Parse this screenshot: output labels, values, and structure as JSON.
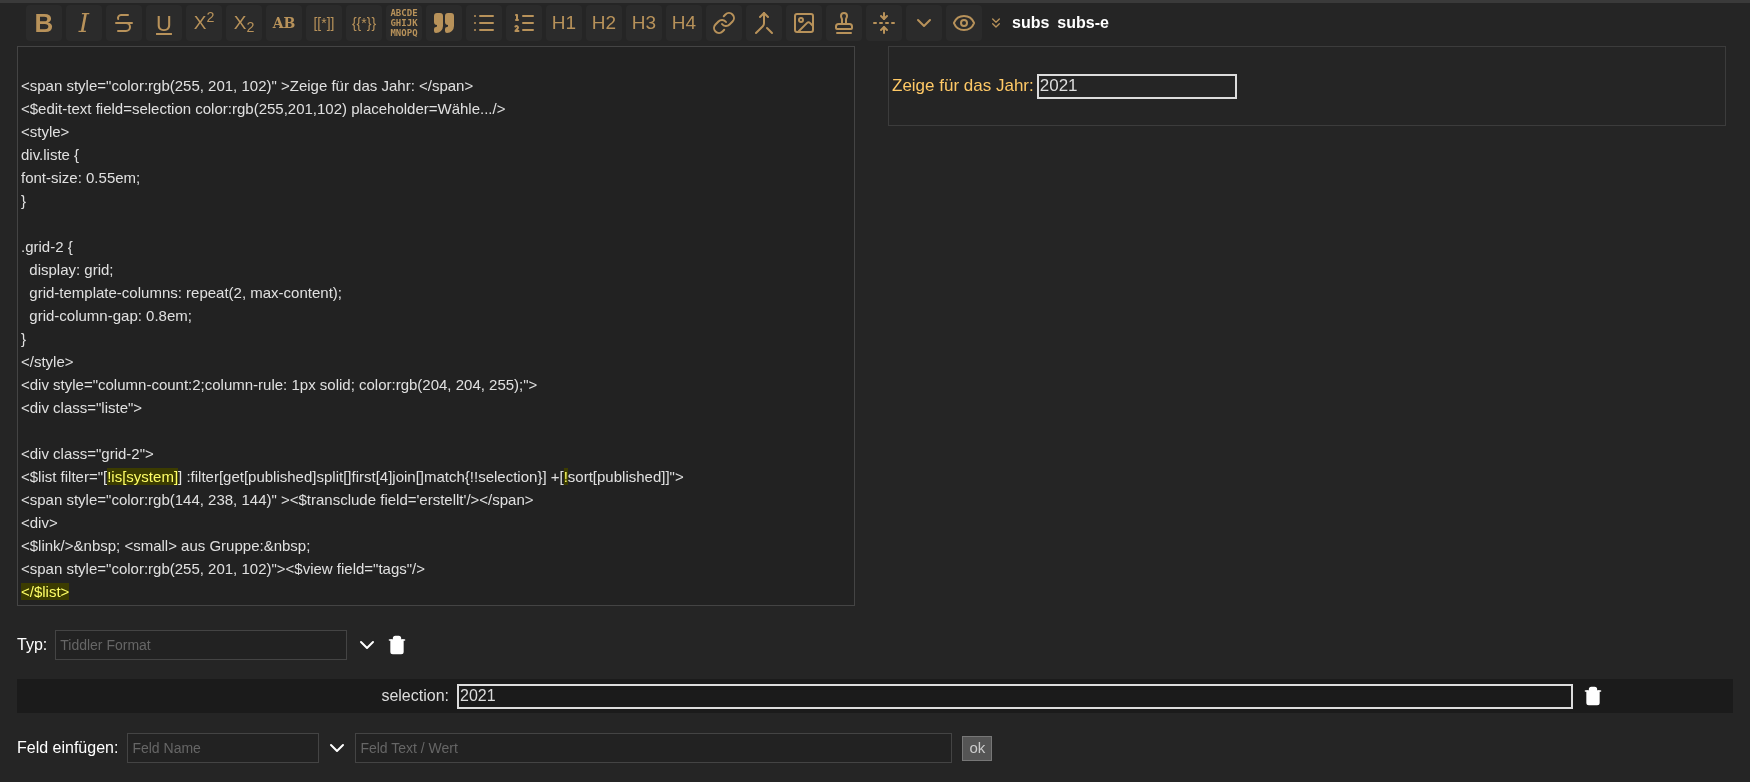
{
  "toolbar": [
    {
      "kind": "bold",
      "label": "B"
    },
    {
      "kind": "italic",
      "label": "I"
    },
    {
      "kind": "strike"
    },
    {
      "kind": "underline",
      "label": "U"
    },
    {
      "kind": "plain",
      "label": "X$^{2}$"
    },
    {
      "kind": "plain",
      "label": "X$_{2}$"
    },
    {
      "kind": "caps",
      "label": "AB"
    },
    {
      "kind": "small",
      "label": "[[*]]"
    },
    {
      "kind": "small",
      "label": "{{*}}"
    },
    {
      "kind": "mono",
      "lines": [
        "ABCDE",
        "GHIJK",
        "MNOPQ"
      ]
    },
    {
      "kind": "quote"
    },
    {
      "kind": "bullets"
    },
    {
      "kind": "numbers"
    },
    {
      "kind": "plain",
      "label": "H1"
    },
    {
      "kind": "plain",
      "label": "H2"
    },
    {
      "kind": "plain",
      "label": "H3"
    },
    {
      "kind": "plain",
      "label": "H4"
    },
    {
      "kind": "link"
    },
    {
      "kind": "transclude"
    },
    {
      "kind": "image"
    },
    {
      "kind": "stamp"
    },
    {
      "kind": "size"
    },
    {
      "kind": "more"
    },
    {
      "kind": "preview"
    },
    {
      "kind": "expand"
    },
    {
      "kind": "word",
      "label": "subs"
    },
    {
      "kind": "word",
      "label": "subs-e"
    }
  ],
  "editor": {
    "lines": [
      {
        "kind": "blank"
      },
      {
        "kind": "code",
        "segments": [
          {
            "text": "<span style=\"color:rgb(255, 201, 102)\" >Zeige für das Jahr: </span>",
            "highlight": false
          }
        ]
      },
      {
        "kind": "code",
        "segments": [
          {
            "text": "<$edit-text field=selection color:rgb(255,201,102) placeholder=Wähle.../>",
            "highlight": false
          }
        ]
      },
      {
        "kind": "code",
        "segments": [
          {
            "text": "<style>",
            "highlight": false
          }
        ]
      },
      {
        "kind": "code",
        "segments": [
          {
            "text": "div.liste {",
            "highlight": false
          }
        ]
      },
      {
        "kind": "code",
        "segments": [
          {
            "text": "font-size: 0.55em;",
            "highlight": false
          }
        ]
      },
      {
        "kind": "code",
        "segments": [
          {
            "text": "}",
            "highlight": false
          }
        ]
      },
      {
        "kind": "blank"
      },
      {
        "kind": "code",
        "segments": [
          {
            "text": ".grid-2 {",
            "highlight": false
          }
        ]
      },
      {
        "kind": "code",
        "segments": [
          {
            "text": "  display: grid;",
            "highlight": false
          }
        ]
      },
      {
        "kind": "code",
        "segments": [
          {
            "text": "  grid-template-columns: repeat(2, max-content);",
            "highlight": false
          }
        ]
      },
      {
        "kind": "code",
        "segments": [
          {
            "text": "  grid-column-gap: 0.8em;",
            "highlight": false
          }
        ]
      },
      {
        "kind": "code",
        "segments": [
          {
            "text": "}",
            "highlight": false
          }
        ]
      },
      {
        "kind": "code",
        "segments": [
          {
            "text": "</style>",
            "highlight": false
          }
        ]
      },
      {
        "kind": "code",
        "segments": [
          {
            "text": "<div style=\"column-count:2;column-rule: 1px solid; color:rgb(204, 204, 255);\">",
            "highlight": false
          }
        ]
      },
      {
        "kind": "code",
        "segments": [
          {
            "text": "<div class=\"liste\">",
            "highlight": false
          }
        ]
      },
      {
        "kind": "blank"
      },
      {
        "kind": "code",
        "segments": [
          {
            "text": "<div class=\"grid-2\">",
            "highlight": false
          }
        ]
      },
      {
        "kind": "code",
        "segments": [
          {
            "text": "<$list filter=\"[",
            "highlight": false
          },
          {
            "text": "!is[system]",
            "highlight": true
          },
          {
            "text": "] :filter[get[published]split[]first[4]join[]match{!!selection}] +[",
            "highlight": false
          },
          {
            "text": "!",
            "highlight": true
          },
          {
            "text": "sort[published]]\">",
            "highlight": false
          }
        ]
      },
      {
        "kind": "code",
        "segments": [
          {
            "text": "<span style=\"color:rgb(144, 238, 144)\" ><$transclude field='erstellt'/></span>",
            "highlight": false
          }
        ]
      },
      {
        "kind": "code",
        "segments": [
          {
            "text": "<div>",
            "highlight": false
          }
        ]
      },
      {
        "kind": "code",
        "segments": [
          {
            "text": "<$link/>&nbsp; <small> aus Gruppe:&nbsp;",
            "highlight": false
          }
        ]
      },
      {
        "kind": "code",
        "segments": [
          {
            "text": "<span style=\"color:rgb(255, 201, 102)\"><$view field=\"tags\"/>",
            "highlight": false
          }
        ]
      },
      {
        "kind": "code",
        "segments": [
          {
            "text": "</$list>",
            "highlight": true
          }
        ]
      }
    ]
  },
  "preview": {
    "label": "Zeige für das Jahr:",
    "value": "2021"
  },
  "type_row": {
    "label": "Typ:",
    "placeholder": "Tiddler Format"
  },
  "fields": [
    {
      "name": "selection:",
      "value": "2021"
    }
  ],
  "add_field": {
    "label": "Feld einfügen:",
    "name_placeholder": "Feld Name",
    "value_placeholder": "Feld Text / Wert",
    "button": "ok"
  }
}
